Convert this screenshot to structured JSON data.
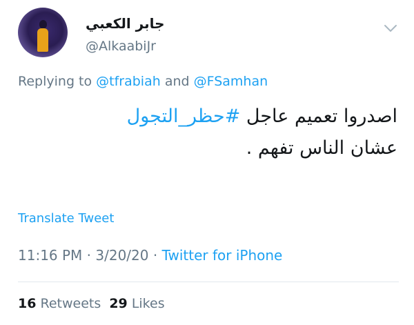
{
  "user": {
    "display_name": "جابر الكعبي",
    "handle": "@AlkaabiJr"
  },
  "reply": {
    "prefix": "Replying to ",
    "mention1": "@tfrabiah",
    "conjunction": " and ",
    "mention2": "@FSamhan"
  },
  "tweet": {
    "part1": "اصدروا تعميم عاجل ",
    "hashtag": "#حظر_التجول",
    "part2": " عشان الناس تفهم ."
  },
  "translate_label": "Translate Tweet",
  "meta": {
    "time": "11:16 PM",
    "sep1": " · ",
    "date": "3/20/20",
    "sep2": " · ",
    "source": "Twitter for iPhone"
  },
  "stats": {
    "retweets_count": "16",
    "retweets_label": " Retweets  ",
    "likes_count": "29",
    "likes_label": " Likes"
  },
  "icons": {
    "avatar": "user-avatar",
    "menu": "chevron-down-icon"
  },
  "colors": {
    "link": "#1da1f2",
    "secondary": "#657786",
    "primary": "#14171a"
  }
}
